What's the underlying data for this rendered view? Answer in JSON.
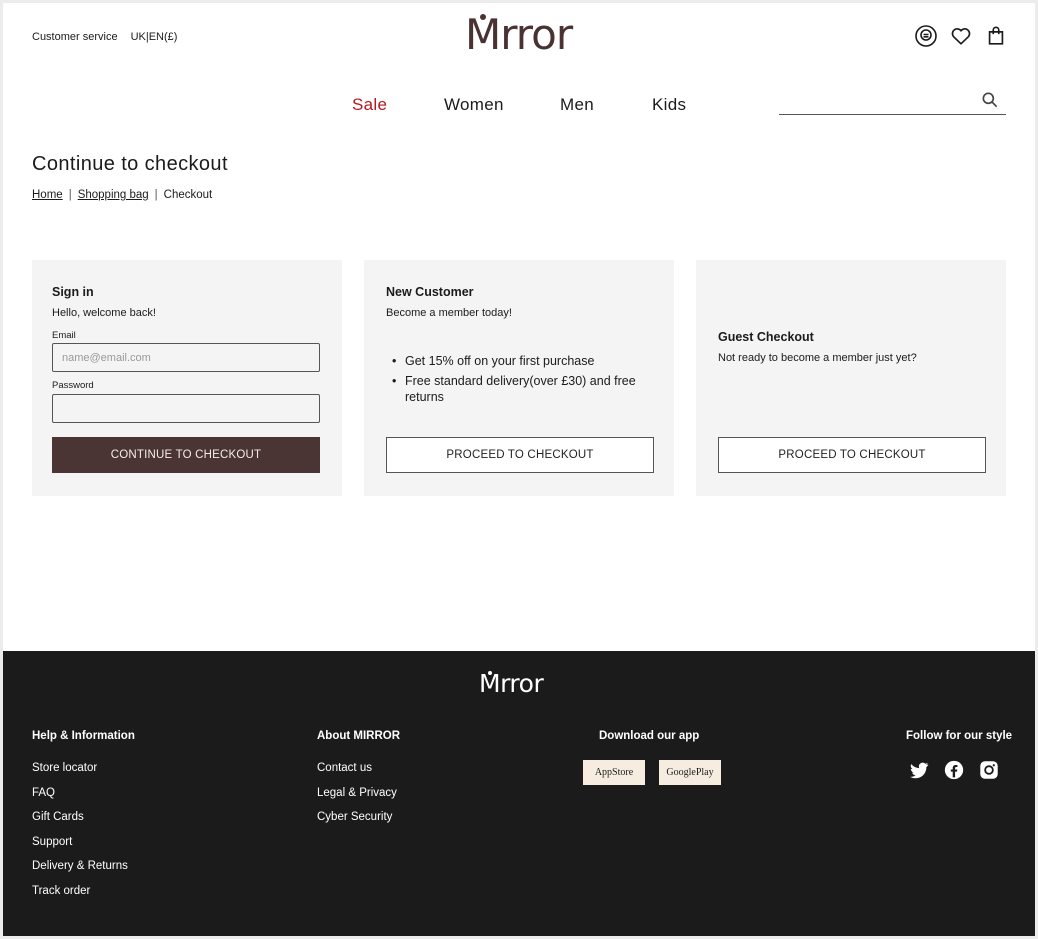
{
  "header": {
    "customer_service": "Customer service",
    "locale": "UK|EN(£)",
    "logo_text": "Mirror",
    "icons": [
      "account-icon",
      "wishlist-heart-icon",
      "shopping-bag-icon"
    ]
  },
  "nav": {
    "items": [
      {
        "label": "Sale",
        "color": "#b3191d"
      },
      {
        "label": "Women"
      },
      {
        "label": "Men"
      },
      {
        "label": "Kids"
      }
    ],
    "search_placeholder": ""
  },
  "page": {
    "title": "Continue to checkout",
    "breadcrumb": [
      "Home",
      "Shopping bag",
      "Checkout"
    ]
  },
  "sign_in": {
    "title": "Sign in",
    "subtitle": "Hello, welcome back!",
    "email_label": "Email",
    "email_placeholder": "name@email.com",
    "password_label": "Password",
    "button": "CONTINUE TO CHECKOUT"
  },
  "new_customer": {
    "title": "New Customer",
    "subtitle": "Become a member today!",
    "perks": [
      "Get 15% off on your first purchase",
      "Free standard delivery(over £30) and free returns"
    ],
    "button": "PROCEED TO CHECKOUT"
  },
  "guest": {
    "title": "Guest Checkout",
    "subtitle": "Not ready to become a member just yet?",
    "button": "PROCEED TO CHECKOUT"
  },
  "footer": {
    "logo_text": "Mirror",
    "help": {
      "title": "Help & Information",
      "links": [
        "Store locator",
        "FAQ",
        "Gift Cards",
        "Support",
        "Delivery & Returns",
        "Track order"
      ]
    },
    "about": {
      "title": "About MIRROR",
      "links": [
        "Contact us",
        "Legal & Privacy",
        "Cyber Security"
      ]
    },
    "app": {
      "title": "Download our app",
      "appstore": "AppStore",
      "googleplay": "GooglePlay"
    },
    "follow": {
      "title": "Follow for our style",
      "icons": [
        "twitter-icon",
        "facebook-icon",
        "instagram-icon"
      ]
    }
  },
  "colors": {
    "brand": "#4a3232",
    "sale": "#b3191d",
    "card_bg": "#f4f4f4",
    "footer_bg": "#1b1b1b",
    "app_button_bg": "#f7ece0"
  }
}
